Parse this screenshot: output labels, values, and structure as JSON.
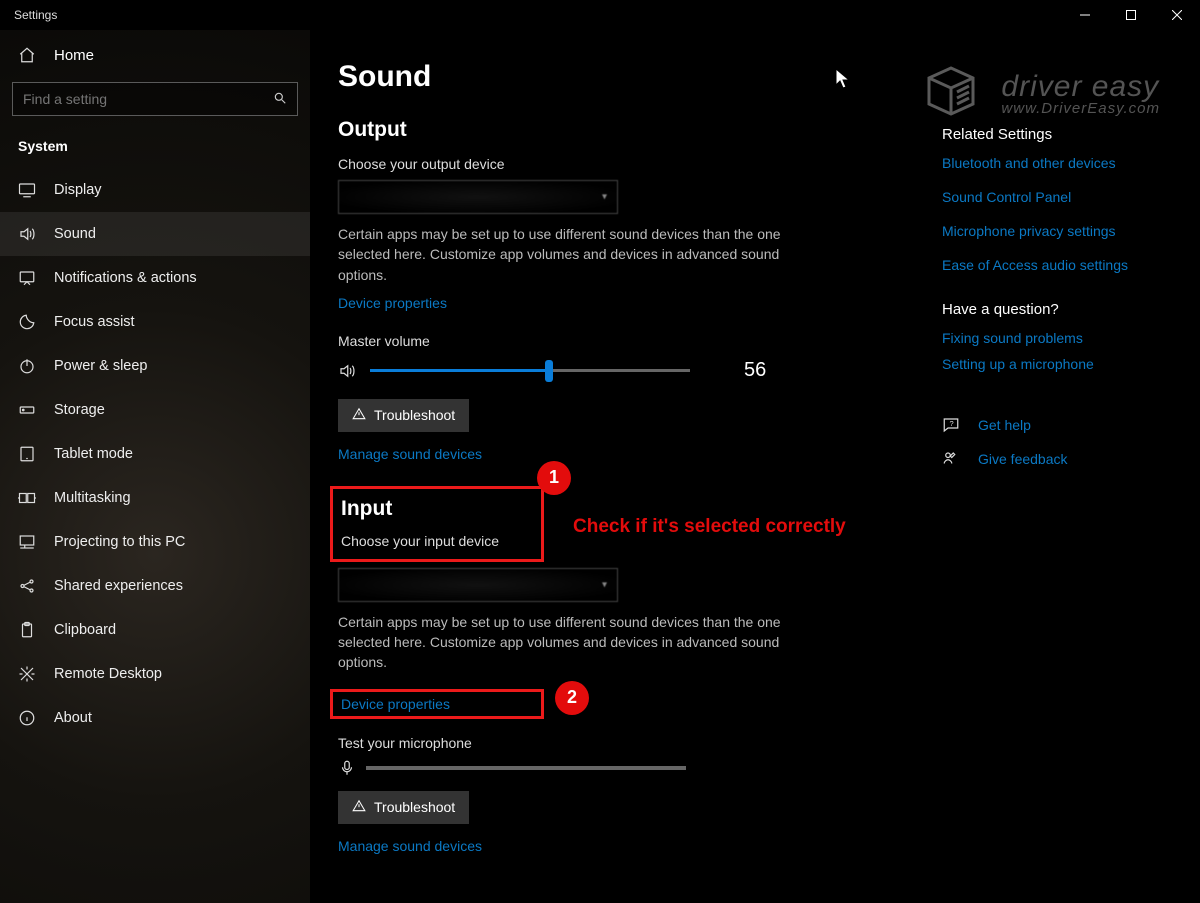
{
  "window_title": "Settings",
  "sidebar": {
    "home": "Home",
    "search_placeholder": "Find a setting",
    "category": "System",
    "items": [
      {
        "label": "Display"
      },
      {
        "label": "Sound",
        "selected": true
      },
      {
        "label": "Notifications & actions"
      },
      {
        "label": "Focus assist"
      },
      {
        "label": "Power & sleep"
      },
      {
        "label": "Storage"
      },
      {
        "label": "Tablet mode"
      },
      {
        "label": "Multitasking"
      },
      {
        "label": "Projecting to this PC"
      },
      {
        "label": "Shared experiences"
      },
      {
        "label": "Clipboard"
      },
      {
        "label": "Remote Desktop"
      },
      {
        "label": "About"
      }
    ]
  },
  "page": {
    "title": "Sound",
    "output": {
      "heading": "Output",
      "choose_label": "Choose your output device",
      "desc": "Certain apps may be set up to use different sound devices than the one selected here. Customize app volumes and devices in advanced sound options.",
      "device_properties": "Device properties",
      "master_volume_label": "Master volume",
      "master_volume_value": 56,
      "troubleshoot": "Troubleshoot",
      "manage_devices": "Manage sound devices"
    },
    "input": {
      "heading": "Input",
      "choose_label": "Choose your input device",
      "desc": "Certain apps may be set up to use different sound devices than the one selected here. Customize app volumes and devices in advanced sound options.",
      "device_properties": "Device properties",
      "test_label": "Test your microphone",
      "troubleshoot": "Troubleshoot",
      "manage_devices": "Manage sound devices"
    }
  },
  "right": {
    "related_heading": "Related Settings",
    "related_links": [
      "Bluetooth and other devices",
      "Sound Control Panel",
      "Microphone privacy settings",
      "Ease of Access audio settings"
    ],
    "question_heading": "Have a question?",
    "question_links": [
      "Fixing sound problems",
      "Setting up a microphone"
    ],
    "get_help": "Get help",
    "give_feedback": "Give feedback"
  },
  "annotations": {
    "num1": "1",
    "num2": "2",
    "text": "Check if it's selected correctly"
  },
  "watermark": {
    "line1": "driver easy",
    "line2": "www.DriverEasy.com"
  }
}
